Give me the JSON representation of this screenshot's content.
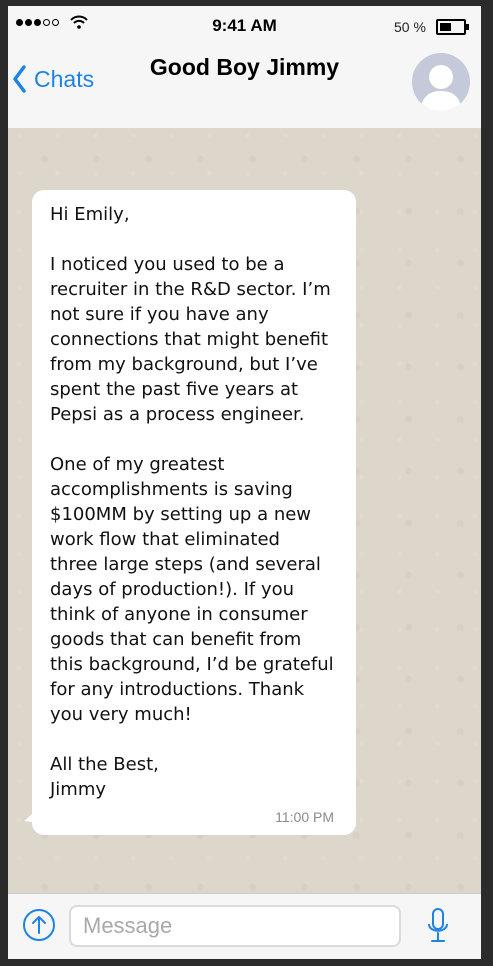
{
  "status_bar": {
    "time": "9:41 AM",
    "battery_percent_label": "50 %",
    "battery_level": 0.5,
    "signal_bars_filled": 3,
    "signal_bars_total": 5,
    "icons": [
      "signal-icon",
      "wifi-icon",
      "battery-icon"
    ]
  },
  "nav": {
    "back_label": "Chats",
    "back_icon": "chevron-left-icon",
    "title": "Good Boy Jimmy",
    "avatar_icon": "default-avatar-icon"
  },
  "colors": {
    "accent": "#1d84e6",
    "chat_background": "#ddd6ca",
    "bubble": "#ffffff",
    "avatar": "#c5cadb"
  },
  "message": {
    "text": "Hi Emily,\n\nI noticed you used to be a\nrecruiter in the R&D sector. I’m\nnot sure if you have any\nconnections that might benefit\nfrom my background, but I’ve\nspent the past five years at\nPepsi as a process engineer.\n\nOne of my greatest\naccomplishments is saving\n$100MM by setting up a new\nwork flow that eliminated\nthree large steps (and several\ndays of production!). If you\nthink of anyone in consumer\ngoods that can benefit from\nthis background, I’d be grateful\nfor any introductions. Thank\nyou very much!\n\nAll the Best,\nJimmy",
    "time": "11:00 PM"
  },
  "input_bar": {
    "placeholder": "Message",
    "value": "",
    "attach_icon": "upload-arrow-icon",
    "mic_icon": "microphone-icon"
  }
}
